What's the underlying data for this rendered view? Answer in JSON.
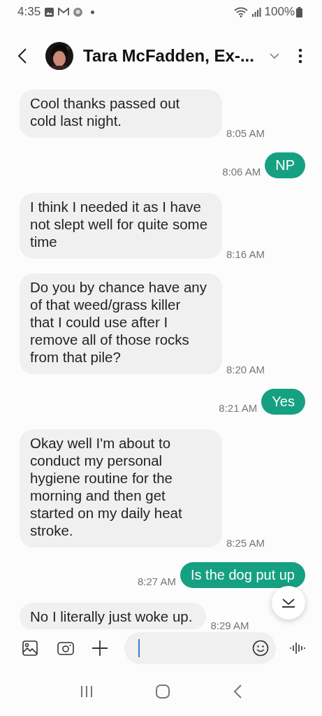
{
  "status_bar": {
    "time": "4:35",
    "battery": "100%"
  },
  "header": {
    "contact_name": "Tara McFadden, Ex-..."
  },
  "messages": [
    {
      "kind": "received",
      "text": "Cool thanks passed out cold last night.",
      "time": "8:05 AM"
    },
    {
      "kind": "sent",
      "text": "NP",
      "time": "8:06 AM"
    },
    {
      "kind": "received",
      "text": "I think I needed it as I have not slept well for quite some time",
      "time": "8:16 AM"
    },
    {
      "kind": "received",
      "text": "Do you by chance have any of that weed/grass killer that I could use after I remove all of those rocks from that pile?",
      "time": "8:20 AM"
    },
    {
      "kind": "sent",
      "text": "Yes",
      "time": "8:21 AM"
    },
    {
      "kind": "received",
      "text": "Okay well I'm about to conduct my personal hygiene routine for the morning and then get started on my daily heat stroke.",
      "time": "8:25 AM"
    },
    {
      "kind": "sent",
      "text": "Is the dog put up",
      "time": "8:27 AM"
    },
    {
      "kind": "received",
      "text": "No I literally just woke up.",
      "time": "8:29 AM"
    }
  ],
  "composer": {
    "cursor": true
  }
}
